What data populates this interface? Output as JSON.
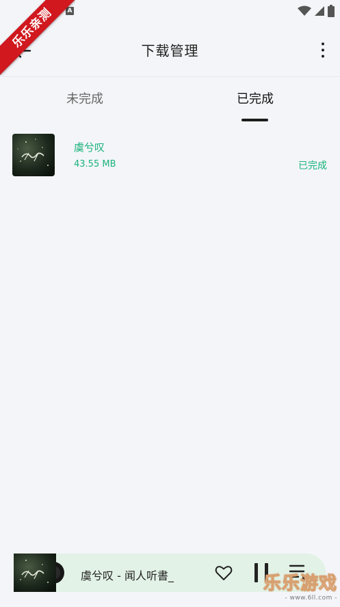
{
  "status_bar": {
    "notification_letter": "A",
    "icons": [
      "wifi-icon",
      "signal-icon",
      "battery-icon"
    ]
  },
  "ribbon": {
    "text": "乐乐亲测"
  },
  "header": {
    "title": "下载管理",
    "back_icon": "back-arrow-icon",
    "more_icon": "more-vertical-icon"
  },
  "tabs": [
    {
      "label": "未完成",
      "active": false
    },
    {
      "label": "已完成",
      "active": true
    }
  ],
  "downloads": [
    {
      "title": "虞兮叹",
      "size": "43.55 MB",
      "status": "已完成"
    }
  ],
  "player": {
    "title": "虞兮叹 - 闻人听書_",
    "icons": [
      "heart-icon",
      "pause-icon",
      "playlist-icon"
    ]
  },
  "watermark": {
    "main": "乐乐游戏",
    "sub": "- www.6ll.com -"
  },
  "colors": {
    "background": "#f4f5f9",
    "accent": "#18b27a",
    "player_bg": "#e2f2e6",
    "ribbon": "#d0181e"
  }
}
